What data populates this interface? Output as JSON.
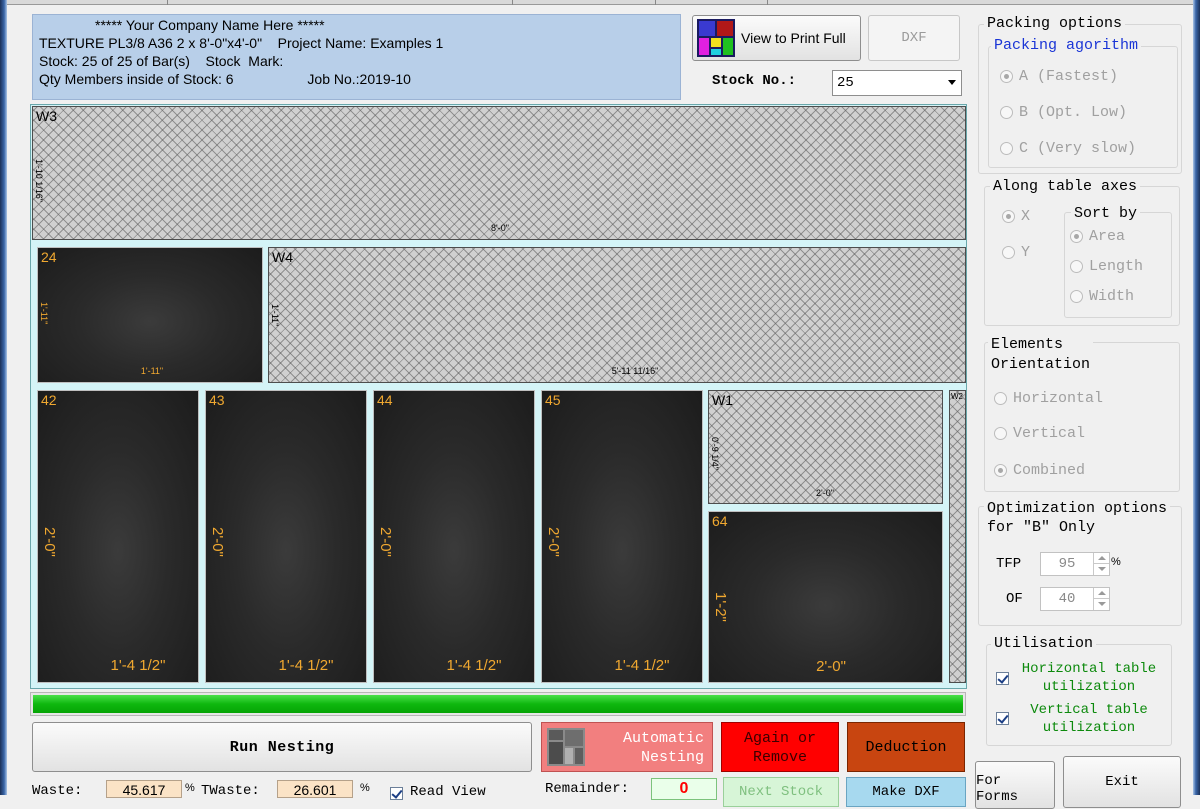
{
  "header": {
    "company_line": "***** Your Company Name Here *****",
    "line2": "TEXTURE PL3/8 A36 2 x 8'-0\"x4'-0\"    Project Name: Examples 1",
    "line3": "Stock: 25 of 25 of Bar(s)    Stock  Mark:",
    "line4": "Qty Members inside of Stock: 6                   Job No.:2019-10"
  },
  "toolbar": {
    "view_print_label": "View to Print Full",
    "dxf_label": "DXF",
    "stock_no_label": "Stock No.:",
    "stock_no_value": "25"
  },
  "nesting": {
    "waste_pieces": [
      {
        "id": "W3",
        "h_dim": "8'-0\"",
        "v_dim": "1'-10 1/16\""
      },
      {
        "id": "W4",
        "h_dim": "5'-11 11/16\"",
        "v_dim": "1'-11\""
      },
      {
        "id": "W1",
        "h_dim": "2'-0\"",
        "v_dim": "0'-9 1/4\""
      },
      {
        "id": "W2"
      }
    ],
    "parts": [
      {
        "id": "24",
        "h_dim": "1'-11\"",
        "v_dim": "1'-11\""
      },
      {
        "id": "42",
        "h_dim": "1'-4 1/2\"",
        "v_dim": "2'-0\""
      },
      {
        "id": "43",
        "h_dim": "1'-4 1/2\"",
        "v_dim": "2'-0\""
      },
      {
        "id": "44",
        "h_dim": "1'-4 1/2\"",
        "v_dim": "2'-0\""
      },
      {
        "id": "45",
        "h_dim": "1'-4 1/2\"",
        "v_dim": "2'-0\""
      },
      {
        "id": "64",
        "h_dim": "2'-0\"",
        "v_dim": "1'-2\""
      }
    ],
    "progress_fraction": 1.0
  },
  "bottom": {
    "run_label": "Run Nesting",
    "auto_line1": "Automatic",
    "auto_line2": "Nesting",
    "again_line1": "Again or",
    "again_line2": "Remove",
    "deduction_label": "Deduction",
    "waste_label": "Waste:",
    "waste_value": "45.617",
    "percent": "%",
    "twaste_label": "TWaste:",
    "twaste_value": "26.601",
    "read_view_label": "Read View",
    "remainder_label": "Remainder:",
    "remainder_value": "0",
    "next_stock_label": "Next Stock",
    "make_dxf_label": "Make DXF",
    "for_label": "For",
    "for_line2": "Forms",
    "exit_label": "Exit"
  },
  "panel": {
    "packing_title": "Packing options",
    "algorithm_title": "Packing agorithm",
    "algo_a": "A (Fastest)",
    "algo_b": "B (Opt. Low)",
    "algo_c": "C (Very slow)",
    "axes_title": "Along table axes",
    "axis_x": "X",
    "axis_y": "Y",
    "sort_title": "Sort by",
    "sort_area": "Area",
    "sort_length": "Length",
    "sort_width": "Width",
    "elements_title_1": "Elements",
    "elements_title_2": "Orientation",
    "orient_h": "Horizontal",
    "orient_v": "Vertical",
    "orient_c": "Combined",
    "opt_title_1": "Optimization options",
    "opt_title_2": "for \"B\" Only",
    "tfp_label": "TFP",
    "tfp_value": "95",
    "tfp_unit": "%",
    "of_label": "OF",
    "of_value": "40",
    "util_title": "Utilisation",
    "util_h_1": "Horizontal table",
    "util_h_2": "utilization",
    "util_v_1": "Vertical table",
    "util_v_2": "utilization"
  },
  "colors": {
    "info_bg": "#b8cfe9",
    "canvas_bg": "#d4f4f7",
    "dim_color": "#f0a830",
    "progress": "#0fb80f",
    "auto_btn": "#f27f7f",
    "again_btn": "#ff0000",
    "deduction_btn": "#c84510",
    "legend_blue": "#1a35d6",
    "util_green": "#0d8a0d"
  }
}
